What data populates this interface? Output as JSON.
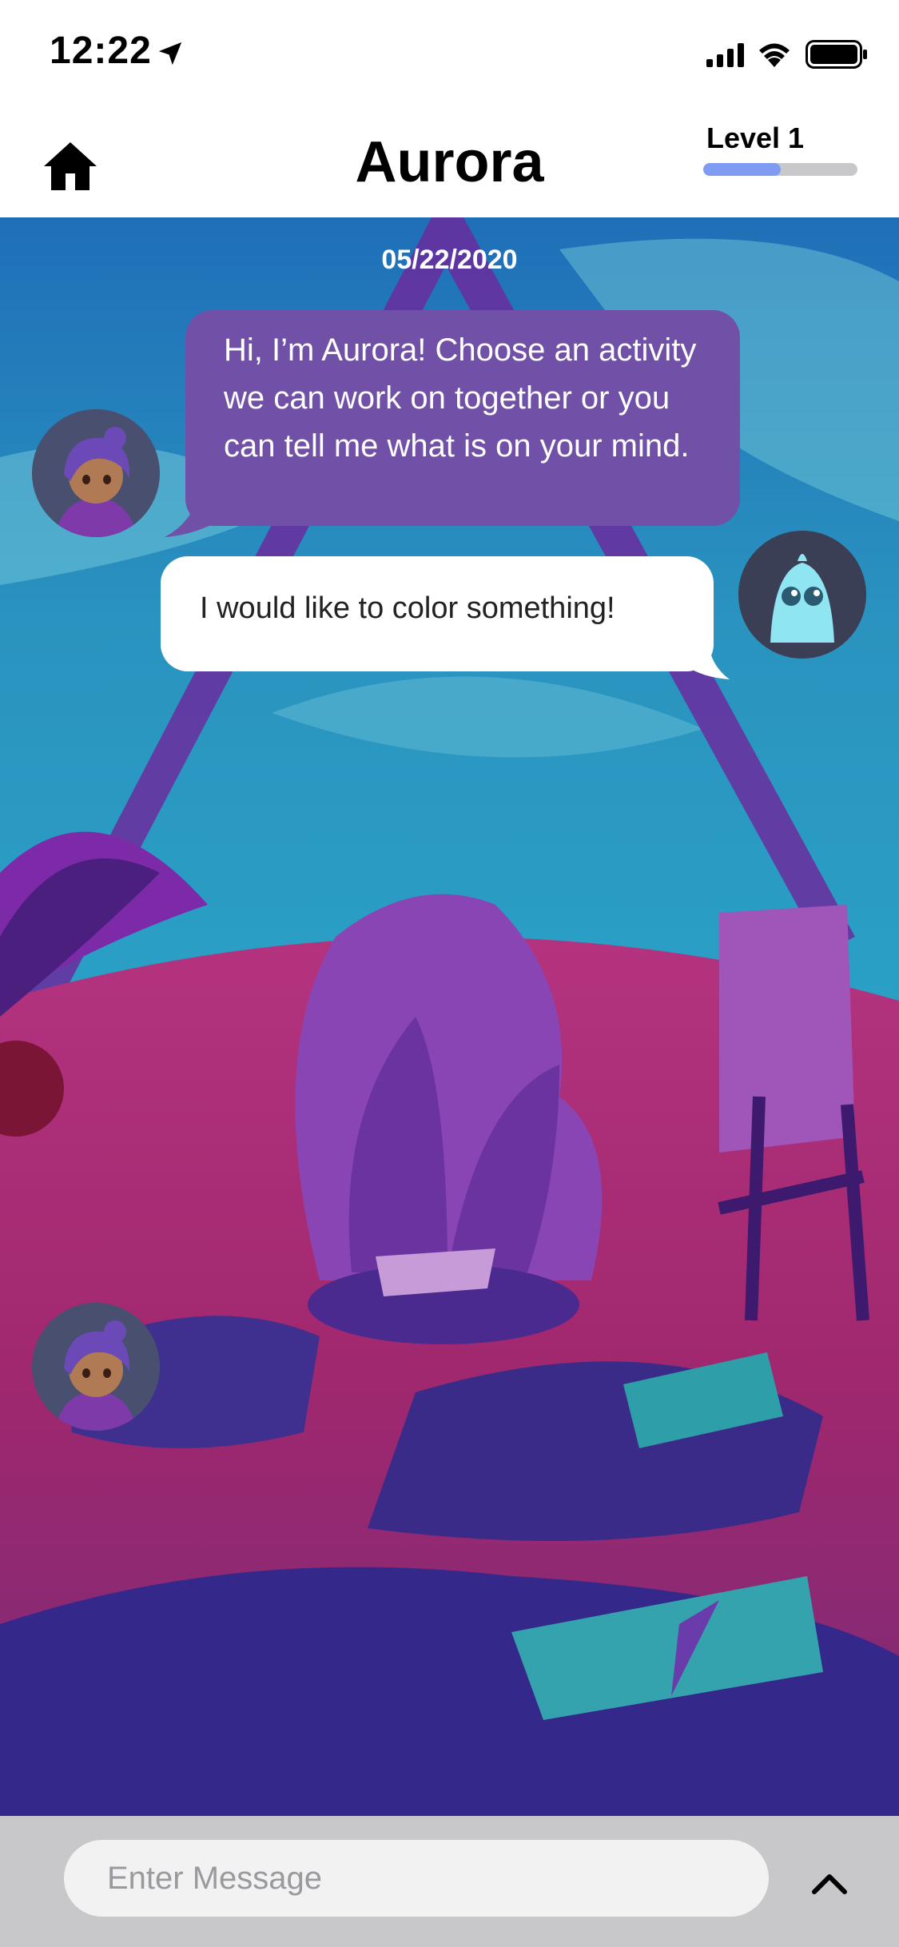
{
  "status_bar": {
    "time": "12:22",
    "icons": [
      "location-arrow-icon",
      "signal-icon",
      "wifi-icon",
      "battery-icon"
    ]
  },
  "header": {
    "title": "Aurora",
    "home_icon": "home-icon",
    "level_label": "Level 1",
    "level_progress": 0.5
  },
  "chat": {
    "date": "05/22/2020",
    "messages": [
      {
        "sender": "bot",
        "text": "Hi, I’m Aurora! Choose an activity we can work on together or you can tell me what is on your mind."
      },
      {
        "sender": "user",
        "text": "I would like to color something!"
      }
    ]
  },
  "input": {
    "placeholder": "Enter Message",
    "send_icon": "chevron-up-icon"
  },
  "colors": {
    "bot_bubble": "#7151a7",
    "progress_fill": "#7f9cf2",
    "progress_track": "#c8c8cb",
    "input_bar": "#c8c8cb"
  }
}
